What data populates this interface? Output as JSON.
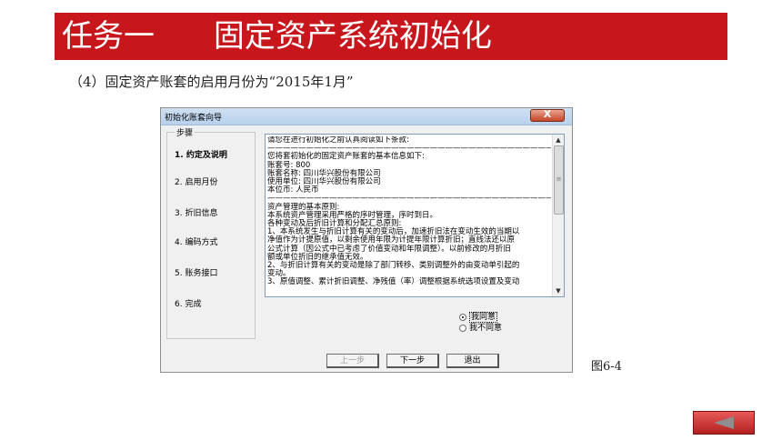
{
  "slide": {
    "title": "任务一      固定资产系统初始化",
    "subtitle": "（4）固定资产账套的启用月份为“2015年1月”",
    "figure_label": "图6-4"
  },
  "dialog": {
    "title": "初始化账套向导",
    "close_label": "X",
    "steps_legend": "步骤",
    "steps": [
      {
        "label": "1. 约定及说明",
        "active": true
      },
      {
        "label": "2. 启用月份"
      },
      {
        "label": "3. 折旧信息"
      },
      {
        "label": "4. 编码方式"
      },
      {
        "label": "5. 账务接口"
      },
      {
        "label": "6. 完成"
      }
    ],
    "agreement_text": "请您在进行初始化之前认真阅读如下条款:\n————————————————————————————————————————\n您将套初始化的固定资产账套的基本信息如下:\n账套号: 800\n账套名称: 四川华兴股份有限公司\n使用单位: 四川华兴股份有限公司\n本位币: 人民币\n————————————————————————————————————————\n资产管理的基本原则:\n本系统资产管理采用严格的序时管理，序时到日。\n各种变动及后折旧计算和分配汇总原则:\n1、本系统发生与折旧计算有关的变动后，加速折旧法在变动生效的当期以\n净值作为计提原值，以剩余使用年限为计提年限计算折旧；直线法还以原\n公式计算（因公式中已考虑了价值变动和年限调整）。以前修改的月折旧\n额或单位折旧的继承值无效。\n2、与折旧计算有关的变动是除了部门转移、类别调整外的由变动单引起的\n变动。\n3、原值调整、累计折旧调整、净残值（率）调整根据系统选项设置及变动",
    "radio_agree": "我同意",
    "radio_disagree": "我不同意",
    "btn_prev": "上一步",
    "btn_next": "下一步",
    "btn_exit": "退出"
  },
  "nav": {
    "back_icon": "triangle-left-icon"
  }
}
